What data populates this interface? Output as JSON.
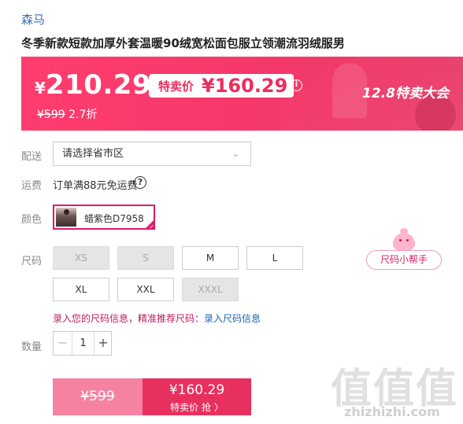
{
  "brand": "森马",
  "title": "冬季新款短款加厚外套温暖90绒宽松面包服立领潮流羽绒服男",
  "banner": {
    "currency": "¥",
    "price": "210.29",
    "sale_label": "特卖价",
    "sale_price": "¥160.29",
    "info_icon": "i",
    "original_price": "¥599",
    "discount": "2.7折",
    "event": "12.8特卖大会",
    "colors": {
      "start": "#ff3d6e",
      "end": "#e83362"
    }
  },
  "delivery": {
    "label": "配送",
    "placeholder": "请选择省市区",
    "chevron": "⌄"
  },
  "shipping": {
    "label": "运费",
    "text": "订单满88元免运费",
    "help_icon": "?"
  },
  "color": {
    "label": "颜色",
    "selected": "蜡紫色D7958",
    "check": "✓"
  },
  "size": {
    "label": "尺码",
    "options": [
      {
        "name": "XS",
        "available": false
      },
      {
        "name": "S",
        "available": false
      },
      {
        "name": "M",
        "available": true
      },
      {
        "name": "L",
        "available": true
      },
      {
        "name": "XL",
        "available": true
      },
      {
        "name": "XXL",
        "available": true
      },
      {
        "name": "XXXL",
        "available": false
      }
    ],
    "helper": "尺码小帮手",
    "note": "录入您的尺码信息，精准推荐尺码：",
    "note_link": "录入尺码信息"
  },
  "quantity": {
    "label": "数量",
    "value": "1",
    "minus": "−",
    "plus": "+"
  },
  "buy": {
    "original": "¥599",
    "sale_price": "¥160.29",
    "action": "特卖价 抢 〉",
    "accent": "#e8305f"
  },
  "watermark": {
    "zh": "值值值",
    "en": "zhizhizhi.com"
  }
}
